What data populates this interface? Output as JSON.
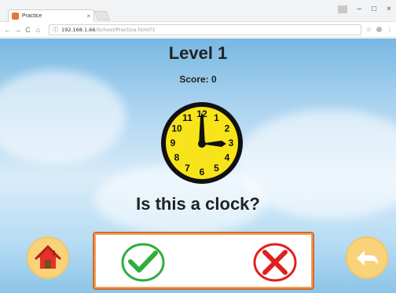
{
  "browser": {
    "tab_title": "Practice",
    "tab_close": "×",
    "url_host": "192.168.1.66",
    "url_path": "/School/Practice.html?1",
    "nav": {
      "back": "←",
      "forward": "→",
      "reload": "C",
      "home": "⌂"
    },
    "window_controls": {
      "minimize": "–",
      "maximize": "□",
      "close": "×"
    },
    "right_icons": {
      "star": "☆",
      "menu": "⋮"
    },
    "info": "ⓘ"
  },
  "game": {
    "level_title": "Level 1",
    "score_text": "Score: 0",
    "question": "Is this a clock?",
    "clock_numbers": [
      "12",
      "1",
      "2",
      "3",
      "4",
      "5",
      "6",
      "7",
      "8",
      "9",
      "10",
      "11"
    ],
    "clock_face_color": "#f7e41b",
    "clock_time": "3:00",
    "accent_orange": "#d46a2d",
    "button_fill": "#f9d37a",
    "check_color": "#2fae3c",
    "cross_color": "#e11f1f"
  }
}
